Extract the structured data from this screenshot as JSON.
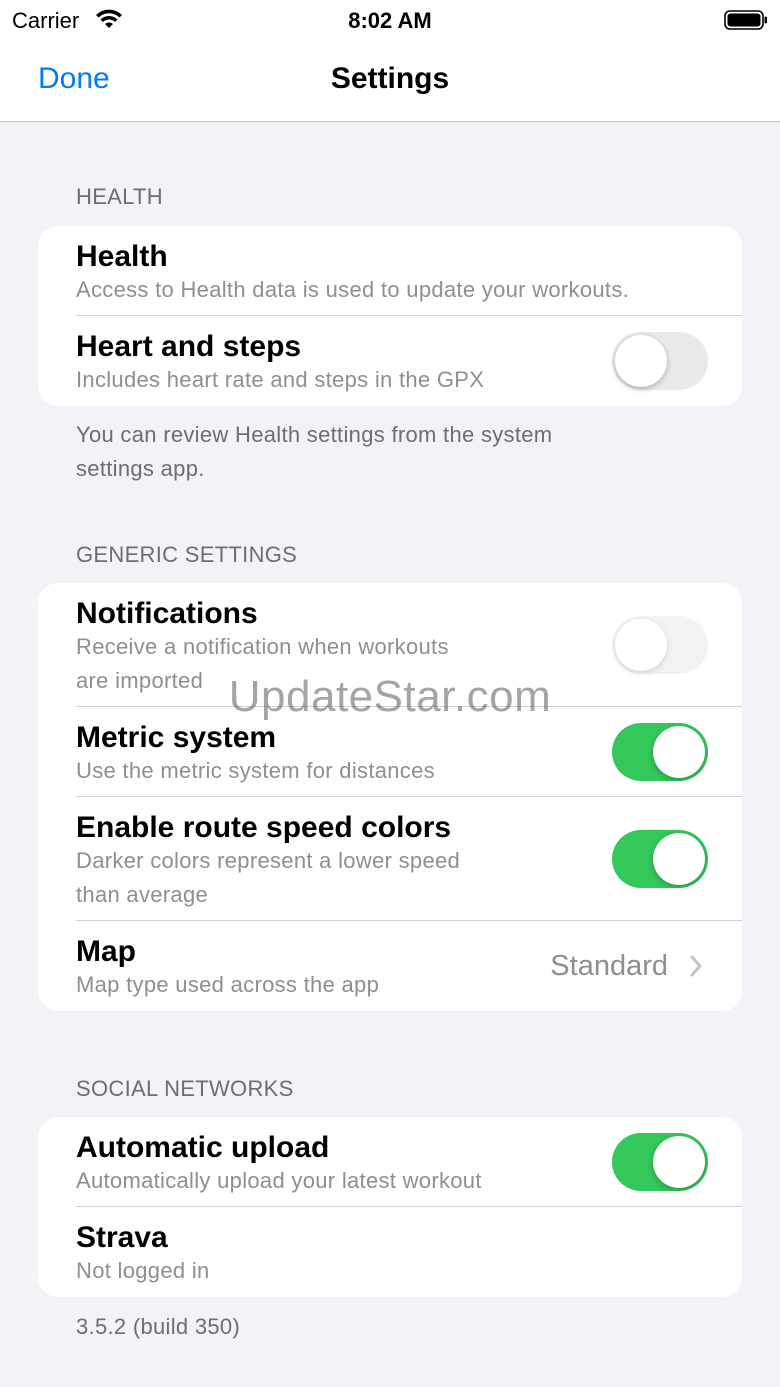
{
  "status_bar": {
    "carrier": "Carrier",
    "time": "8:02 AM"
  },
  "nav": {
    "done_label": "Done",
    "title": "Settings"
  },
  "health": {
    "header": "HEALTH",
    "rows": [
      {
        "title": "Health",
        "subtitle": "Access to Health data is used to update your workouts."
      },
      {
        "title": "Heart and steps",
        "subtitle": "Includes heart rate and steps in the GPX",
        "toggle_on": false
      }
    ],
    "footer_line1": "You can review Health settings from the system",
    "footer_line2": "settings app."
  },
  "generic": {
    "header": "GENERIC SETTINGS",
    "rows": [
      {
        "title": "Notifications",
        "subtitle_line1": "Receive a notification when workouts",
        "subtitle_line2": "are imported",
        "toggle_on": false
      },
      {
        "title": "Metric system",
        "subtitle": "Use the metric system for distances",
        "toggle_on": true
      },
      {
        "title": "Enable route speed colors",
        "subtitle_line1": "Darker colors represent a lower speed",
        "subtitle_line2": "than average",
        "toggle_on": true
      },
      {
        "title": "Map",
        "subtitle": "Map type used across the app",
        "value": "Standard"
      }
    ]
  },
  "social": {
    "header": "SOCIAL NETWORKS",
    "rows": [
      {
        "title": "Automatic upload",
        "subtitle": "Automatically upload your latest workout",
        "toggle_on": true
      },
      {
        "title": "Strava",
        "subtitle": "Not logged in"
      }
    ]
  },
  "version": "3.5.2 (build 350)",
  "watermark": "UpdateStar.com",
  "colors": {
    "accent": "#007aff",
    "toggle_on": "#34c759",
    "background": "#f2f2f7"
  },
  "icons": [
    "wifi-icon",
    "battery-icon",
    "chevron-right-icon"
  ]
}
